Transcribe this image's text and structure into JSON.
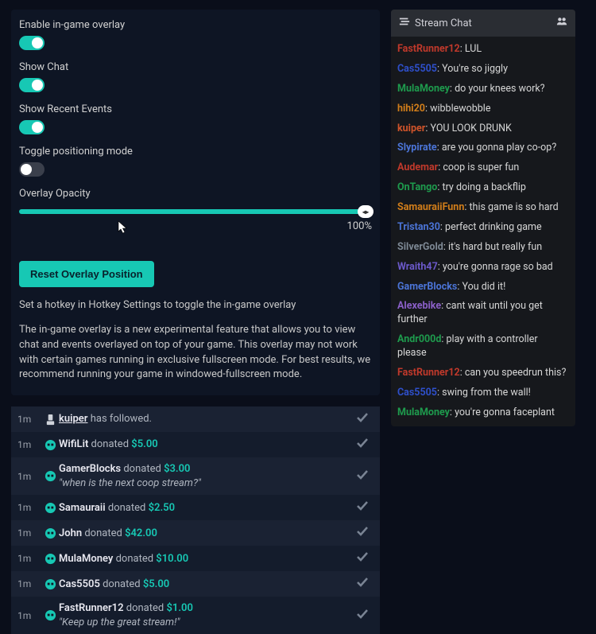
{
  "settings": {
    "enable_overlay": {
      "label": "Enable in-game overlay",
      "on": true
    },
    "show_chat": {
      "label": "Show Chat",
      "on": true
    },
    "show_events": {
      "label": "Show Recent Events",
      "on": true
    },
    "positioning": {
      "label": "Toggle positioning mode",
      "on": false
    },
    "opacity": {
      "label": "Overlay Opacity",
      "value": "100%"
    },
    "reset_label": "Reset Overlay Position",
    "hint": "Set a hotkey in Hotkey Settings to toggle the in-game overlay",
    "desc": "The in-game overlay is a new experimental feature that allows you to view chat and events overlayed on top of your game. This overlay may not work with certain games running in exclusive fullscreen mode. For best results, we recommend running your game in windowed-fullscreen mode."
  },
  "events": [
    {
      "time": "1m",
      "type": "follow",
      "user": "kuiper",
      "text": "has followed."
    },
    {
      "time": "1m",
      "type": "donate",
      "user": "WifiLit",
      "text": "donated",
      "amount": "$5.00"
    },
    {
      "time": "1m",
      "type": "donate",
      "user": "GamerBlocks",
      "text": "donated",
      "amount": "$3.00",
      "msg": "\"when is the next coop stream?\""
    },
    {
      "time": "1m",
      "type": "donate",
      "user": "Samauraii",
      "text": "donated",
      "amount": "$2.50"
    },
    {
      "time": "1m",
      "type": "donate",
      "user": "John",
      "text": "donated",
      "amount": "$42.00"
    },
    {
      "time": "1m",
      "type": "donate",
      "user": "MulaMoney",
      "text": "donated",
      "amount": "$10.00"
    },
    {
      "time": "1m",
      "type": "donate",
      "user": "Cas5505",
      "text": "donated",
      "amount": "$5.00"
    },
    {
      "time": "1m",
      "type": "donate",
      "user": "FastRunner12",
      "text": "donated",
      "amount": "$1.00",
      "msg": "\"Keep up the great stream!\""
    }
  ],
  "chat": {
    "title": "Stream Chat",
    "lines": [
      {
        "u": "FastRunner12",
        "c": "#c0392b",
        "m": "LUL"
      },
      {
        "u": "Cas5505",
        "c": "#2e4fc9",
        "m": "You're so jiggly"
      },
      {
        "u": "MulaMoney",
        "c": "#1e9b4d",
        "m": "do your knees work?"
      },
      {
        "u": "hihi20",
        "c": "#d07d1a",
        "m": "wibblewobble"
      },
      {
        "u": "kuiper",
        "c": "#d0542a",
        "m": "YOU LOOK DRUNK"
      },
      {
        "u": "Slypirate",
        "c": "#4b74d6",
        "m": "are you gonna play co-op?"
      },
      {
        "u": "Audemar",
        "c": "#c0392b",
        "m": "coop is super fun"
      },
      {
        "u": "OnTango",
        "c": "#1e9b4d",
        "m": "try doing a backflip"
      },
      {
        "u": "SamauraiiFunn",
        "c": "#d07d1a",
        "m": "this game is so hard"
      },
      {
        "u": "Tristan30",
        "c": "#4b74d6",
        "m": "perfect drinking game"
      },
      {
        "u": "SilverGold",
        "c": "#7d8894",
        "m": "it's hard but really fun"
      },
      {
        "u": "Wraith47",
        "c": "#6b59c9",
        "m": "you're gonna rage so bad"
      },
      {
        "u": "GamerBlocks",
        "c": "#4b74d6",
        "m": "You did it!"
      },
      {
        "u": "Alexebike",
        "c": "#8a5fc7",
        "m": "cant wait until you get further"
      },
      {
        "u": "Andr000d",
        "c": "#1e9b4d",
        "m": "play with a controller please"
      },
      {
        "u": "FastRunner12",
        "c": "#c0392b",
        "m": "can you speedrun this?"
      },
      {
        "u": "Cas5505",
        "c": "#2e4fc9",
        "m": "swing from the wall!"
      },
      {
        "u": "MulaMoney",
        "c": "#1e9b4d",
        "m": "you're gonna faceplant"
      }
    ]
  }
}
